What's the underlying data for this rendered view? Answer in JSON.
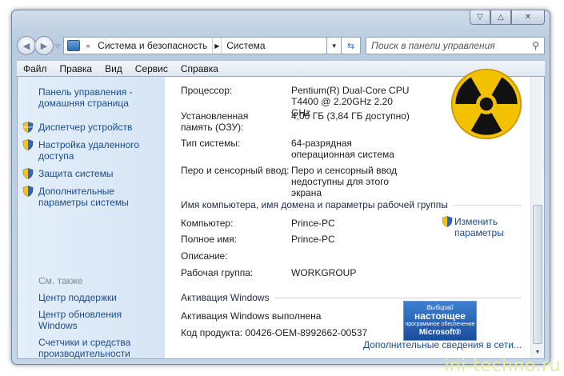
{
  "address": {
    "crumbs": [
      "Система и безопасность",
      "Система"
    ],
    "search_placeholder": "Поиск в панели управления"
  },
  "menu": [
    "Файл",
    "Правка",
    "Вид",
    "Сервис",
    "Справка"
  ],
  "sidebar": {
    "home": "Панель управления - домашняя страница",
    "links": [
      "Диспетчер устройств",
      "Настройка удаленного доступа",
      "Защита системы",
      "Дополнительные параметры системы"
    ],
    "see_also_title": "См. также",
    "see_also": [
      "Центр поддержки",
      "Центр обновления Windows",
      "Счетчики и средства производительности"
    ]
  },
  "system": {
    "processor_label": "Процессор:",
    "processor_value": "Pentium(R) Dual-Core CPU T4400  @ 2.20GHz   2.20 GHz",
    "memory_label": "Установленная память (ОЗУ):",
    "memory_value": "4,00 ГБ (3,84 ГБ доступно)",
    "type_label": "Тип системы:",
    "type_value": "64-разрядная операционная система",
    "pen_label": "Перо и сенсорный ввод:",
    "pen_value": "Перо и сенсорный ввод недоступны для этого экрана"
  },
  "computer": {
    "section_title": "Имя компьютера, имя домена и параметры рабочей группы",
    "computer_label": "Компьютер:",
    "computer_value": "Prince-PC",
    "fullname_label": "Полное имя:",
    "fullname_value": "Prince-PC",
    "description_label": "Описание:",
    "workgroup_label": "Рабочая группа:",
    "workgroup_value": "WORKGROUP",
    "change_link": "Изменить параметры"
  },
  "activation": {
    "section_title": "Активация Windows",
    "status": "Активация Windows выполнена",
    "product_key": "Код продукта:  00426-OEM-8992662-00537",
    "more_link": "Дополнительные сведения в сети...",
    "genuine_badge": [
      "Выбирай",
      "настоящее",
      "программное обеспечение",
      "Microsoft®"
    ]
  },
  "watermark": "ini-techno.ru",
  "colors": {
    "link": "#1c4c8c",
    "sidebar": "#dce9f7",
    "radiation_yellow": "#f2c100"
  }
}
